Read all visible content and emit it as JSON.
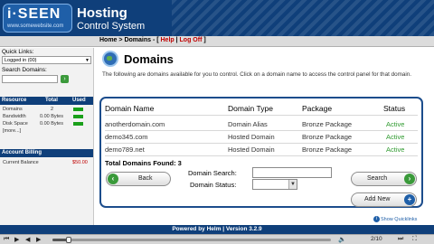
{
  "header": {
    "logo_text": "i·SEEN",
    "logo_sub": "www.somewebsite.com",
    "title": "Hosting",
    "subtitle": "Control System"
  },
  "nav": {
    "home": "Home",
    "sep1": " > ",
    "domains": "Domains",
    "sep2": " - [ ",
    "help": "Help",
    "sep3": " | ",
    "logoff": "Log Off",
    "sep4": " ]"
  },
  "sidebar": {
    "quick_links_label": "Quick Links:",
    "quick_links_value": "Logged in (00)",
    "search_domains_label": "Search Domains:",
    "resource_headers": [
      "Resource",
      "Total",
      "Used"
    ],
    "resources": [
      {
        "name": "Domains",
        "total": "2",
        "used_fraction": 1.0
      },
      {
        "name": "Bandwidth",
        "total": "0.00 Bytes",
        "used_fraction": 1.0
      },
      {
        "name": "Disk Space",
        "total": "0.00 Bytes",
        "used_fraction": 1.0
      },
      {
        "name": "[more...]",
        "total": "",
        "used_fraction": 0
      }
    ],
    "billing_title": "Account Billing",
    "billing_label": "Current Balance",
    "billing_value": "$50.00"
  },
  "main": {
    "title": "Domains",
    "intro": "The following are domains available for you to control. Click on a domain name to access the control panel for that domain.",
    "columns": [
      "Domain Name",
      "Domain Type",
      "Package",
      "Status"
    ],
    "rows": [
      {
        "name": "anotherdomain.com",
        "type": "Domain Alias",
        "package": "Bronze Package",
        "status": "Active"
      },
      {
        "name": "demo345.com",
        "type": "Hosted Domain",
        "package": "Bronze Package",
        "status": "Active"
      },
      {
        "name": "demo789.net",
        "type": "Hosted Domain",
        "package": "Bronze Package",
        "status": "Active"
      }
    ],
    "total_label": "Total Domains Found: 3",
    "search_label": "Domain Search:",
    "status_label": "Domain Status:",
    "back_label": "Back",
    "search_button": "Search",
    "add_new_button": "Add New",
    "show_quick": "Show Quicklinks"
  },
  "footer": {
    "text": "Powered by Helm  |  Version 3.2.9"
  },
  "player": {
    "counter": "2/10",
    "progress_fraction": 0.06
  },
  "colors": {
    "brand_blue": "#0f3f7a",
    "active_green": "#2f9a2f",
    "alert_red": "#c00000"
  }
}
